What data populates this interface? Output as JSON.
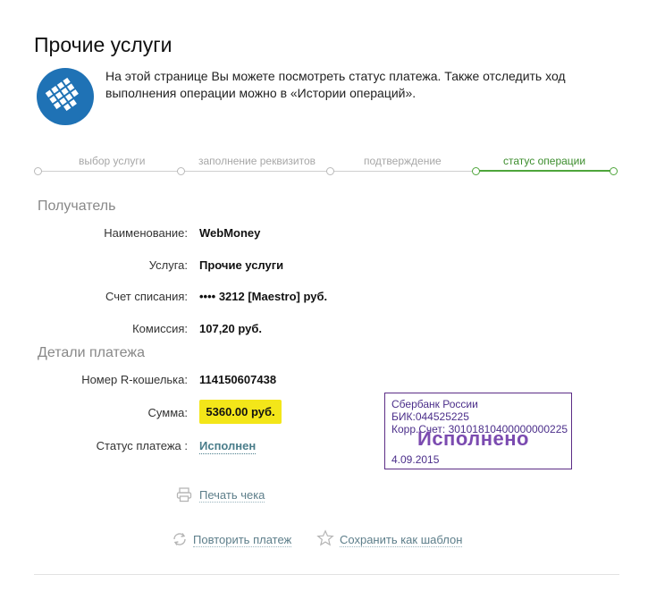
{
  "page": {
    "title": "Прочие услуги",
    "intro": "На этой странице Вы можете посмотреть статус платежа. Также отследить ход выполнения операции можно в «Истории операций»."
  },
  "steps": [
    {
      "label": "выбор услуги",
      "active": false
    },
    {
      "label": "заполнение реквизитов",
      "active": false
    },
    {
      "label": "подтверждение",
      "active": false
    },
    {
      "label": "статус операции",
      "active": true
    }
  ],
  "recipient": {
    "section_title": "Получатель",
    "name_label": "Наименование:",
    "name_value": "WebMoney",
    "service_label": "Услуга:",
    "service_value": "Прочие услуги",
    "account_label": "Счет списания:",
    "account_value": "•••• 3212  [Maestro]  руб.",
    "fee_label": "Комиссия:",
    "fee_value": "107,20 руб."
  },
  "payment": {
    "section_title": "Детали платежа",
    "wallet_label": "Номер R-кошелька:",
    "wallet_value": "114150607438",
    "sum_label": "Сумма:",
    "sum_value": "5360.00 руб.",
    "status_label": "Статус платежа :",
    "status_value": "Исполнен"
  },
  "stamp": {
    "bank": "Сбербанк России",
    "bik": "БИК:044525225",
    "corr": "Корр.Счет: 30101810400000000225",
    "status": "Исполнено",
    "date": "4.09.2015"
  },
  "actions": {
    "print": "Печать чека",
    "repeat": "Повторить платеж",
    "save_template": "Сохранить как шаблон"
  },
  "colors": {
    "accent_green": "#4ea53b",
    "highlight_yellow": "#f3e619",
    "stamp_purple": "#5c2d86",
    "link": "#5d7e8a"
  },
  "icons": [
    "webmoney-logo",
    "printer-icon",
    "repeat-icon",
    "star-icon"
  ]
}
